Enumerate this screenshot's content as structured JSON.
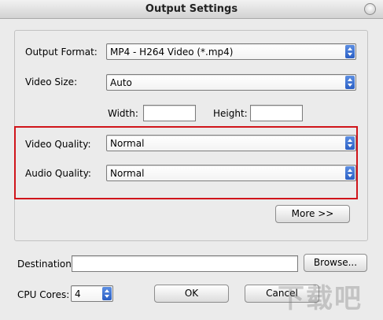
{
  "window": {
    "title": "Output Settings",
    "close_icon": "close-icon"
  },
  "settings": {
    "output_format": {
      "label": "Output Format:",
      "value": "MP4 - H264 Video (*.mp4)"
    },
    "video_size": {
      "label": "Video Size:",
      "value": "Auto"
    },
    "width": {
      "label": "Width:",
      "value": ""
    },
    "height": {
      "label": "Height:",
      "value": ""
    },
    "video_quality": {
      "label": "Video Quality:",
      "value": "Normal"
    },
    "audio_quality": {
      "label": "Audio Quality:",
      "value": "Normal"
    },
    "more_label": "More >>"
  },
  "destination": {
    "label": "Destination:",
    "value": "",
    "browse_label": "Browse..."
  },
  "cpu": {
    "label": "CPU Cores:",
    "value": "4"
  },
  "buttons": {
    "ok": "OK",
    "cancel": "Cancel"
  },
  "watermark": {
    "text": "下载吧"
  },
  "colors": {
    "highlight_border": "#d0151b",
    "spinner_blue": "#2a5fc4"
  }
}
